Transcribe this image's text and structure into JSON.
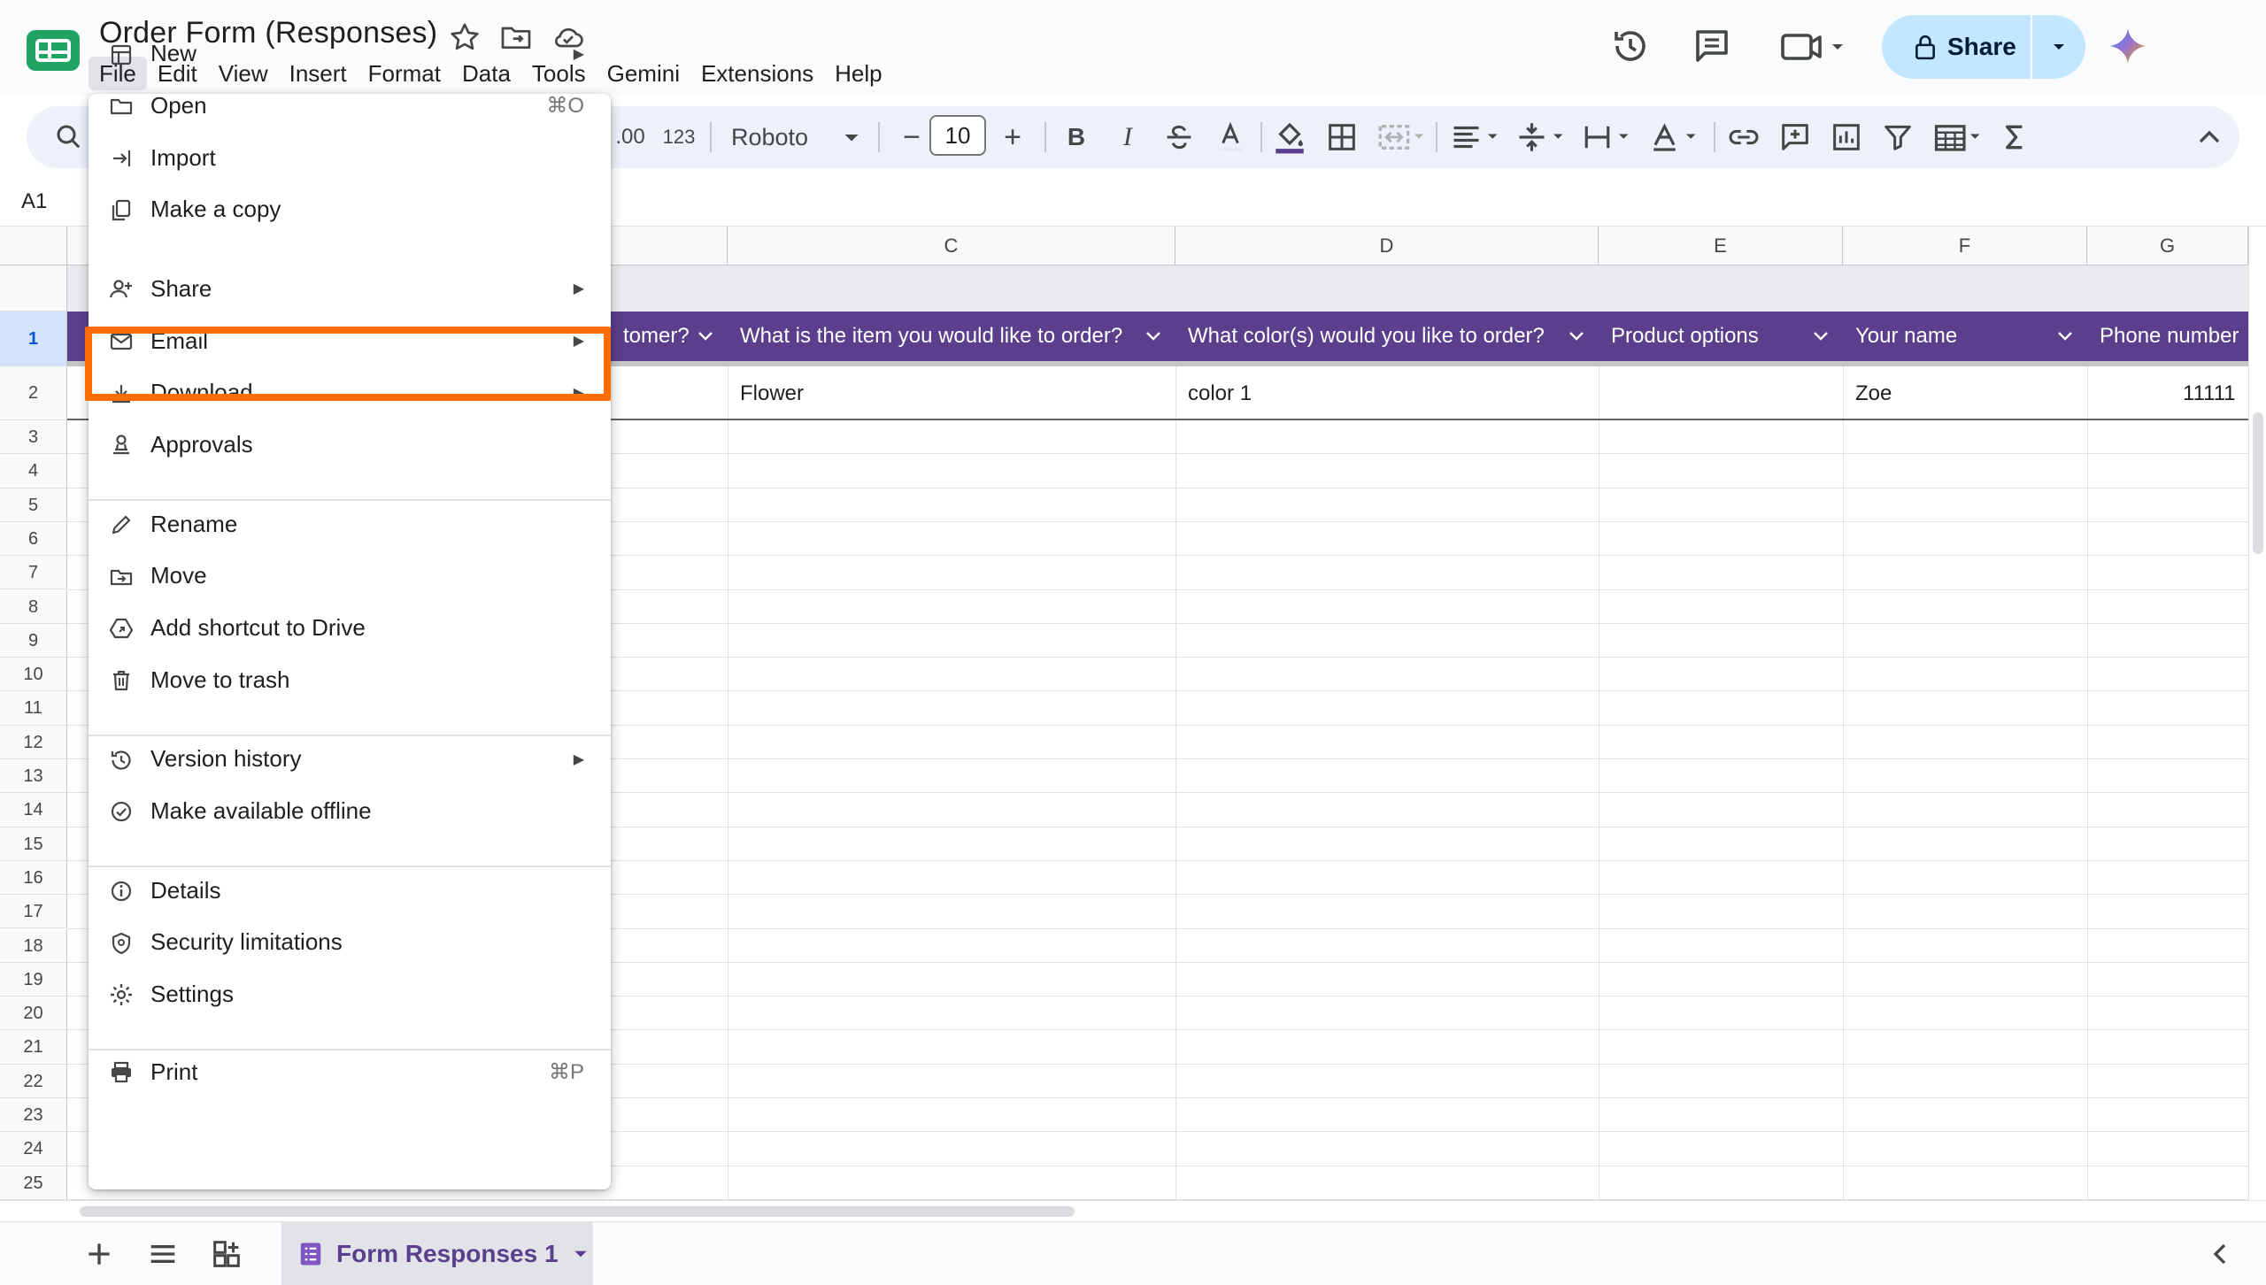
{
  "app": {
    "doc_title": "Order Form (Responses)",
    "menus": [
      "File",
      "Edit",
      "View",
      "Insert",
      "Format",
      "Data",
      "Tools",
      "Gemini",
      "Extensions",
      "Help"
    ],
    "share_label": "Share"
  },
  "toolbar": {
    "decimal_label": ".00",
    "number_format_label": "123",
    "font_name": "Roboto",
    "font_size": "10",
    "minus_label": "−",
    "plus_label": "+",
    "bold_label": "B",
    "italic_label": "I"
  },
  "formula_bar": {
    "name_box": "A1"
  },
  "grid": {
    "columns": [
      "C",
      "D",
      "E",
      "F",
      "G"
    ],
    "rows": [
      "1",
      "2",
      "3",
      "4",
      "5",
      "6",
      "7",
      "8",
      "9",
      "10",
      "11",
      "12",
      "13",
      "14",
      "15",
      "16",
      "17",
      "18",
      "19",
      "20",
      "21",
      "22",
      "23",
      "24",
      "25"
    ],
    "header_cells": [
      "tomer?",
      "What is the item you would like to order?",
      "What color(s) would you like to order?",
      "Product options",
      "Your name",
      "Phone number"
    ],
    "row2": {
      "item": "Flower",
      "color": "color 1",
      "name": "Zoe",
      "phone": "11111"
    }
  },
  "sheetbar": {
    "tab_label": "Form Responses 1"
  },
  "file_menu": {
    "items": [
      {
        "label": "New",
        "icon": "new-sheet-icon",
        "submenu": true
      },
      {
        "label": "Open",
        "icon": "folder-icon",
        "shortcut": "⌘O"
      },
      {
        "label": "Import",
        "icon": "import-icon"
      },
      {
        "label": "Make a copy",
        "icon": "copy-icon"
      },
      {
        "label": "Share",
        "icon": "person-add-icon",
        "submenu": true
      },
      {
        "label": "Email",
        "icon": "email-icon",
        "submenu": true
      },
      {
        "label": "Download",
        "icon": "download-icon",
        "submenu": true
      },
      {
        "label": "Approvals",
        "icon": "approvals-icon"
      },
      {
        "label": "Rename",
        "icon": "pencil-icon"
      },
      {
        "label": "Move",
        "icon": "move-folder-icon"
      },
      {
        "label": "Add shortcut to Drive",
        "icon": "drive-shortcut-icon"
      },
      {
        "label": "Move to trash",
        "icon": "trash-icon"
      },
      {
        "label": "Version history",
        "icon": "history-icon",
        "submenu": true
      },
      {
        "label": "Make available offline",
        "icon": "offline-icon"
      },
      {
        "label": "Details",
        "icon": "info-icon"
      },
      {
        "label": "Security limitations",
        "icon": "shield-icon"
      },
      {
        "label": "Settings",
        "icon": "gear-icon"
      },
      {
        "label": "Print",
        "icon": "print-icon",
        "shortcut": "⌘P"
      }
    ]
  },
  "colors": {
    "header_row_bg": "#5b3f8c",
    "share_button_bg": "#c2e7ff",
    "highlight": "#ff6d00",
    "logo_green": "#1fa463"
  }
}
